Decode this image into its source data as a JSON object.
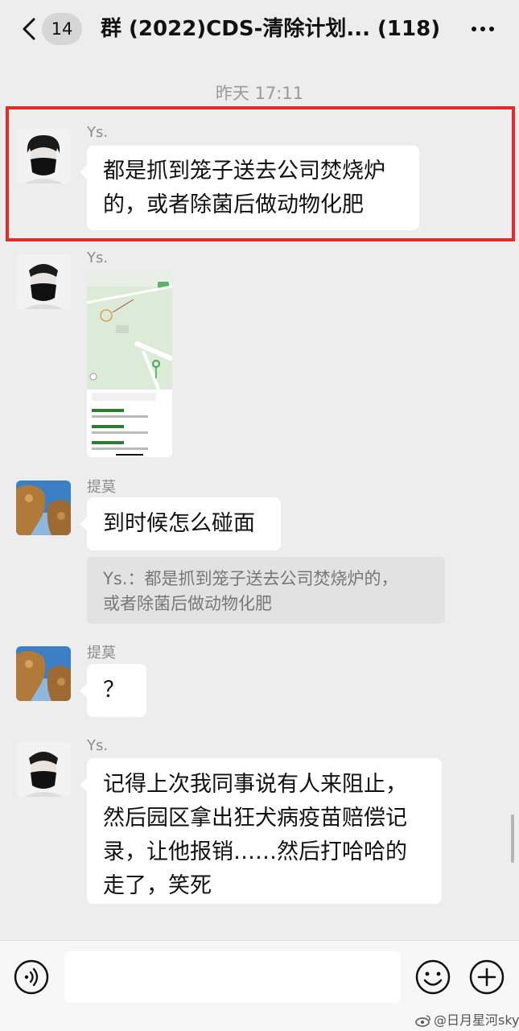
{
  "header": {
    "back_count": "14",
    "title": "群 (2022)CDS-清除计划...  (118)"
  },
  "timestamp": "昨天 17:11",
  "messages": [
    {
      "sender": "Ys.",
      "text_lines": [
        "都是抓到笼子送去公司焚烧炉",
        "的，或者除菌后做动物化肥"
      ]
    },
    {
      "sender": "Ys.",
      "type": "image"
    },
    {
      "sender": "提莫",
      "text": "到时候怎么碰面",
      "quote_lines": [
        "Ys.：都是抓到笼子送去公司焚烧炉的，",
        "或者除菌后做动物化肥"
      ]
    },
    {
      "sender": "提莫",
      "text": "？"
    },
    {
      "sender": "Ys.",
      "text_lines": [
        "记得上次我同事说有人来阻止，",
        "然后园区拿出狂犬病疫苗赔偿记",
        "录，让他报销……然后打哈哈的",
        "走了，笑死"
      ]
    }
  ],
  "watermark": "@日月星河sky",
  "colors": {
    "highlight": "#e32b2b",
    "background": "#ededed",
    "bubble": "#ffffff"
  }
}
